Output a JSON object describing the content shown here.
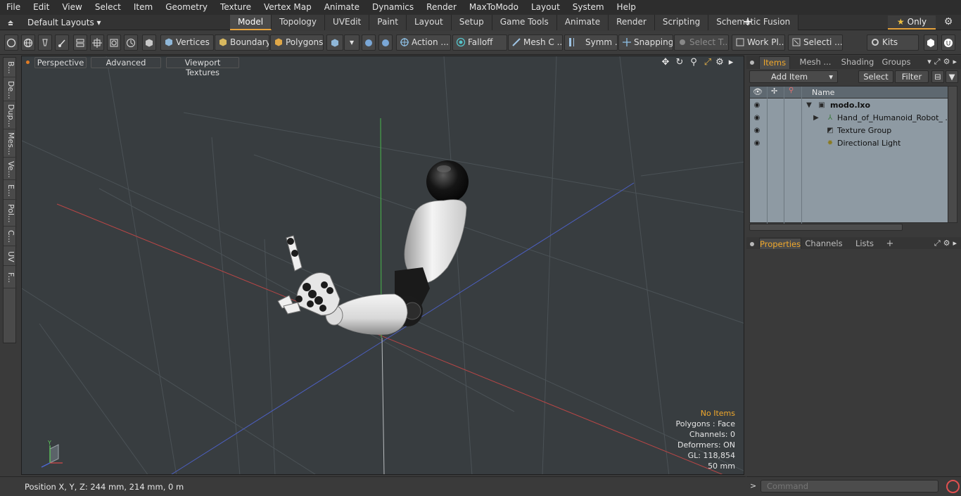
{
  "menu": [
    "File",
    "Edit",
    "View",
    "Select",
    "Item",
    "Geometry",
    "Texture",
    "Vertex Map",
    "Animate",
    "Dynamics",
    "Render",
    "MaxToModo",
    "Layout",
    "System",
    "Help"
  ],
  "layout": {
    "selector": "Default Layouts ▾"
  },
  "mode_tabs": [
    "Model",
    "Topology",
    "UVEdit",
    "Paint",
    "Layout",
    "Setup",
    "Game Tools",
    "Animate",
    "Render",
    "Scripting",
    "Schematic Fusion"
  ],
  "active_mode": "Model",
  "only_label": "Only",
  "toolbar": {
    "vertices": "Vertices",
    "boundary": "Boundary",
    "polygons": "Polygons",
    "action": "Action",
    "falloff": "Falloff",
    "mesh_c": "Mesh C ...",
    "symm": "Symm ...",
    "snapping": "Snapping",
    "select_t": "Select T...",
    "work_pl": "Work Pl...",
    "selecti": "Selecti ...",
    "kits": "Kits"
  },
  "left_tabs": [
    "B...",
    "De...",
    "Dup...",
    "Mes...",
    "Ve...",
    "E...",
    "Pol...",
    "C...",
    "UV",
    "F..."
  ],
  "viewport": {
    "buttons": [
      "Perspective",
      "Advanced",
      "Viewport Textures"
    ],
    "stats": {
      "no_items": "No Items",
      "polygons": "Polygons : Face",
      "channels": "Channels: 0",
      "deformers": "Deformers: ON",
      "gl": "GL: 118,854",
      "scale": "50 mm"
    },
    "axis_labels": {
      "y": "Y"
    }
  },
  "status": {
    "position": "Position X, Y, Z:   244 mm, 214 mm, 0 m"
  },
  "items_panel": {
    "tabs": [
      "Items",
      "Mesh ...",
      "Shading",
      "Groups"
    ],
    "add_item": "Add Item",
    "select": "Select",
    "filter": "Filter",
    "name_header": "Name",
    "rows": [
      {
        "label": "modo.lxo"
      },
      {
        "label": "Hand_of_Humanoid_Robot_ ..."
      },
      {
        "label": "Texture Group"
      },
      {
        "label": "Directional Light"
      }
    ]
  },
  "props_panel": {
    "tabs": [
      "Properties",
      "Channels",
      "Lists"
    ]
  },
  "command": {
    "placeholder": "Command"
  },
  "colors": {
    "accent": "#e6a23c",
    "viewport_bg": "#383d40",
    "list_bg": "#8e9aa3"
  }
}
